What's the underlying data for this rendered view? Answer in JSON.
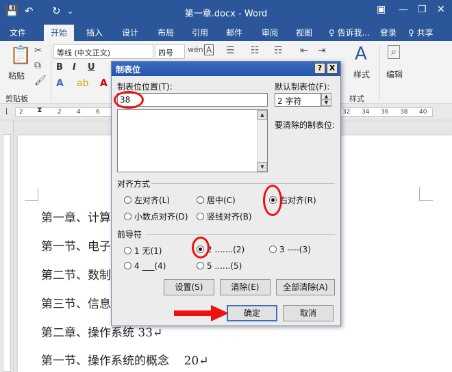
{
  "window": {
    "title": "第一章.docx - Word"
  },
  "titlebar_icons": [
    "save-icon",
    "undo-icon",
    "redo-icon",
    "customize-icon",
    "ribbon-display-icon",
    "minimize-icon",
    "restore-icon",
    "close-icon"
  ],
  "tabs": [
    "文件",
    "开始",
    "插入",
    "设计",
    "布局",
    "引用",
    "邮件",
    "审阅",
    "视图"
  ],
  "active_tab": "开始",
  "tell_me": "♀ 告诉我...",
  "signin": "登录",
  "share": "♀ 共享",
  "ribbon": {
    "paste": "粘贴",
    "clipboard": "剪贴板",
    "font_name": "等线 (中文正文)",
    "font_size": "四号",
    "bold": "B",
    "italic": "I",
    "underline": "U",
    "styles": "样式",
    "styles_group": "样式",
    "editing": "编辑"
  },
  "ruler_numbers": [
    "2",
    "2",
    "4",
    "6",
    "32",
    "34",
    "36",
    "38",
    "40"
  ],
  "document_lines": [
    "第一章、计算",
    "第一节、电子",
    "第二节、数制",
    "第三节、信息",
    "第二章、操作系统 33↵",
    "第一节、操作系统的概念    20↵"
  ],
  "dialog": {
    "title": "制表位",
    "help": "?",
    "close": "X",
    "tab_stop_label": "制表位位置(T):",
    "tab_stop_value": "38",
    "default_label": "默认制表位(F):",
    "default_value": "2 字符",
    "clear_label": "要清除的制表位:",
    "alignment_label": "对齐方式",
    "alignment": [
      {
        "label": "左对齐(L)",
        "checked": false
      },
      {
        "label": "居中(C)",
        "checked": false
      },
      {
        "label": "右对齐(R)",
        "checked": true
      },
      {
        "label": "小数点对齐(D)",
        "checked": false
      },
      {
        "label": "竖线对齐(B)",
        "checked": false
      }
    ],
    "leader_label": "前导符",
    "leader": [
      {
        "label": "1 无(1)",
        "checked": false
      },
      {
        "label": "2 .......(2)",
        "checked": true
      },
      {
        "label": "3 ----(3)",
        "checked": false
      },
      {
        "label": "4 ___(4)",
        "checked": false
      },
      {
        "label": "5 ......(5)",
        "checked": false
      }
    ],
    "set_button": "设置(S)",
    "clear_button": "清除(E)",
    "clear_all_button": "全部清除(A)",
    "ok_button": "确定",
    "cancel_button": "取消"
  },
  "annotation_color": "#e11111"
}
